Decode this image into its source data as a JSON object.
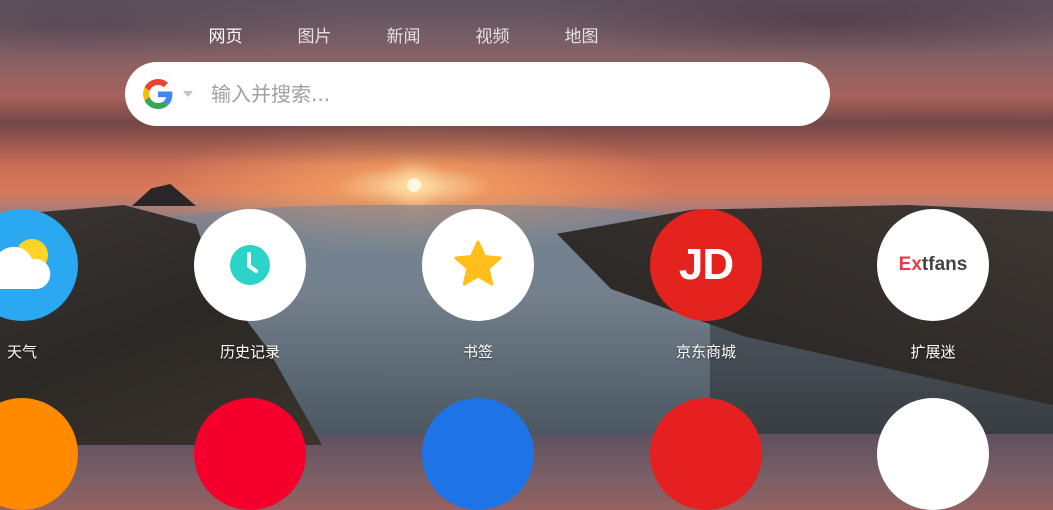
{
  "nav": {
    "tabs": [
      {
        "label": "网页",
        "active": true
      },
      {
        "label": "图片",
        "active": false
      },
      {
        "label": "新闻",
        "active": false
      },
      {
        "label": "视频",
        "active": false
      },
      {
        "label": "地图",
        "active": false
      }
    ]
  },
  "search": {
    "engine_icon": "google-g-icon",
    "placeholder": "输入并搜索...",
    "value": ""
  },
  "shortcuts": [
    {
      "label": "天气",
      "icon": "weather-cloud-sun-icon",
      "color": "#2aa8f2"
    },
    {
      "label": "历史记录",
      "icon": "clock-icon",
      "color": "#2cd3c8"
    },
    {
      "label": "书签",
      "icon": "star-icon",
      "color": "#ffbe1a"
    },
    {
      "label": "京东商城",
      "icon": "jd-logo",
      "logo_text": "JD",
      "color": "#e4231f"
    },
    {
      "label": "扩展迷",
      "icon": "extfans-logo",
      "logo_text_accent": "Ex",
      "logo_text_rest": "tfans",
      "color": "#e83a48"
    }
  ],
  "second_row_colors": [
    "#ff8a00",
    "#f5002d",
    "#1e74e6",
    "#e62020",
    "#ffffff"
  ]
}
